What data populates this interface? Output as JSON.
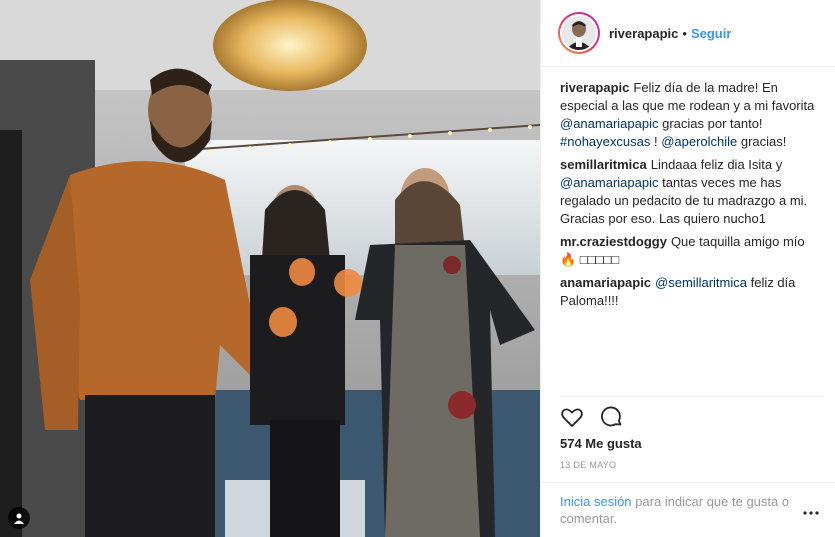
{
  "post": {
    "username": "riverapapic",
    "separator": "•",
    "follow_label": "Seguir"
  },
  "comments": [
    {
      "user": "riverapapic",
      "parts": [
        {
          "t": "Feliz día de la madre! En especial a las que me rodean y a mi favorita "
        },
        {
          "tag": "@anamariapapic"
        },
        {
          "t": " gracias por tanto! "
        },
        {
          "tag": "#nohayexcusas"
        },
        {
          "t": " ! "
        },
        {
          "tag": "@aperolchile"
        },
        {
          "t": " gracias!"
        }
      ]
    },
    {
      "user": "semillaritmica",
      "parts": [
        {
          "t": "Lindaaa feliz dia Isita y "
        },
        {
          "tag": "@anamariapapic"
        },
        {
          "t": " tantas veces me has regalado un pedacito de tu madrazgo a mi. Gracias por eso. Las quiero nucho1"
        }
      ]
    },
    {
      "user": "mr.craziestdoggy",
      "parts": [
        {
          "t": "Que taquilla amigo mío 🔥 □□□□□"
        }
      ]
    },
    {
      "user": "anamariapapic",
      "parts": [
        {
          "tag": "@semillaritmica"
        },
        {
          "t": " feliz día Paloma!!!!"
        }
      ]
    }
  ],
  "likes": "574 Me gusta",
  "date": "13 DE MAYO",
  "login": {
    "link": "Inicia sesión",
    "rest": " para indicar que te gusta o comentar."
  },
  "icons": {
    "like": "heart-icon",
    "comment": "comment-icon",
    "more": "more-options-icon",
    "user_tag": "user-tag-icon"
  },
  "colors": {
    "link": "#3897f0",
    "tag": "#003569",
    "muted": "#999999"
  }
}
